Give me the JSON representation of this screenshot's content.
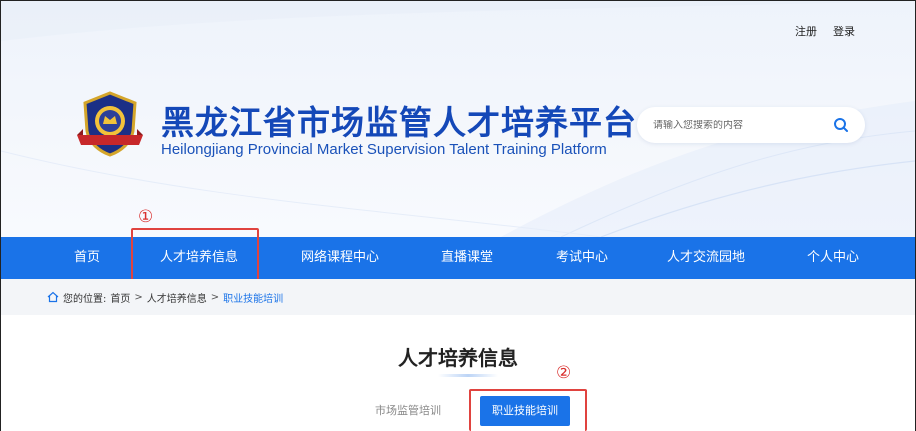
{
  "header": {
    "auth": {
      "register": "注册",
      "login": "登录"
    },
    "title_zh": "黑龙江省市场监管人才培养平台",
    "title_en": "Heilongjiang Provincial Market Supervision Talent Training Platform",
    "search_placeholder": "请输入您搜索的内容",
    "logo": "emblem-icon"
  },
  "annotations": {
    "marker1": "①",
    "marker2": "②"
  },
  "nav": {
    "items": [
      "首页",
      "人才培养信息",
      "网络课程中心",
      "直播课堂",
      "考试中心",
      "人才交流园地",
      "个人中心"
    ]
  },
  "breadcrumb": {
    "prefix": "您的位置:",
    "items": [
      "首页",
      "人才培养信息",
      "职业技能培训"
    ],
    "separator": ">"
  },
  "content": {
    "title": "人才培养信息",
    "tabs": [
      {
        "label": "市场监管培训",
        "active": false
      },
      {
        "label": "职业技能培训",
        "active": true
      }
    ]
  },
  "colors": {
    "brand": "#1a73e8",
    "title": "#1448b8",
    "highlight": "#e0433f"
  }
}
